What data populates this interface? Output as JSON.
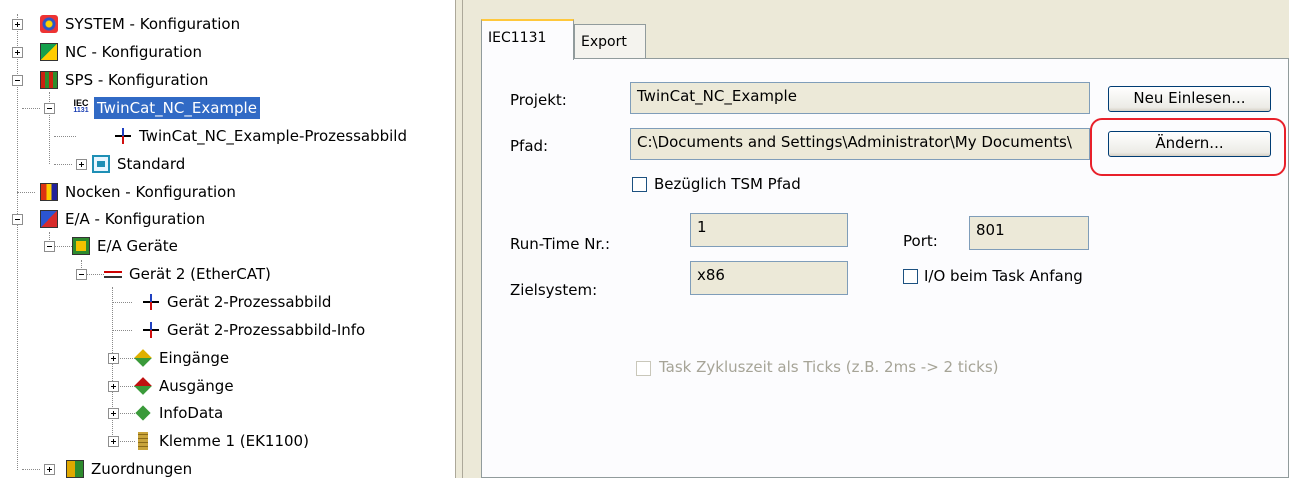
{
  "tree": {
    "items": [
      {
        "label": "SYSTEM - Konfiguration",
        "icon": "system-config-icon"
      },
      {
        "label": "NC - Konfiguration",
        "icon": "nc-config-icon"
      },
      {
        "label": "SPS - Konfiguration",
        "icon": "plc-config-icon"
      },
      {
        "label": "TwinCat_NC_Example",
        "icon": "iec1131-icon",
        "selected": true
      },
      {
        "label": "TwinCat_NC_Example-Prozessabbild",
        "icon": "process-image-icon"
      },
      {
        "label": "Standard",
        "icon": "standard-task-icon"
      },
      {
        "label": "Nocken - Konfiguration",
        "icon": "cam-config-icon"
      },
      {
        "label": "E/A - Konfiguration",
        "icon": "io-config-icon"
      },
      {
        "label": "E/A Geräte",
        "icon": "io-devices-icon"
      },
      {
        "label": "Gerät 2 (EtherCAT)",
        "icon": "ethercat-device-icon"
      },
      {
        "label": "Gerät 2-Prozessabbild",
        "icon": "process-image-icon"
      },
      {
        "label": "Gerät 2-Prozessabbild-Info",
        "icon": "process-image-icon"
      },
      {
        "label": "Eingänge",
        "icon": "inputs-icon"
      },
      {
        "label": "Ausgänge",
        "icon": "outputs-icon"
      },
      {
        "label": "InfoData",
        "icon": "infodata-icon"
      },
      {
        "label": "Klemme 1 (EK1100)",
        "icon": "terminal-icon"
      },
      {
        "label": "Zuordnungen",
        "icon": "mappings-icon"
      }
    ]
  },
  "tabs": [
    {
      "label": "IEC1131",
      "active": true
    },
    {
      "label": "Export",
      "active": false
    }
  ],
  "form": {
    "projekt_label": "Projekt:",
    "projekt_value": "TwinCat_NC_Example",
    "pfad_label": "Pfad:",
    "pfad_value": "C:\\Documents and Settings\\Administrator\\My Documents\\",
    "neu_einlesen_label": "Neu Einlesen...",
    "aendern_label": "Ändern...",
    "tsm_pfad_label": "Bezüglich TSM Pfad",
    "tsm_pfad_checked": false,
    "runtime_label": "Run-Time Nr.:",
    "runtime_value": "1",
    "port_label": "Port:",
    "port_value": "801",
    "zielsystem_label": "Zielsystem:",
    "zielsystem_value": "x86",
    "io_task_label": "I/O beim Task Anfang",
    "io_task_checked": false,
    "ticks_label": "Task Zykluszeit als Ticks (z.B. 2ms -> 2 ticks)",
    "ticks_enabled": false
  },
  "colors": {
    "selection": "#316ac5",
    "highlight_ring": "#e8202a",
    "panel_bg": "#ece9d8"
  }
}
